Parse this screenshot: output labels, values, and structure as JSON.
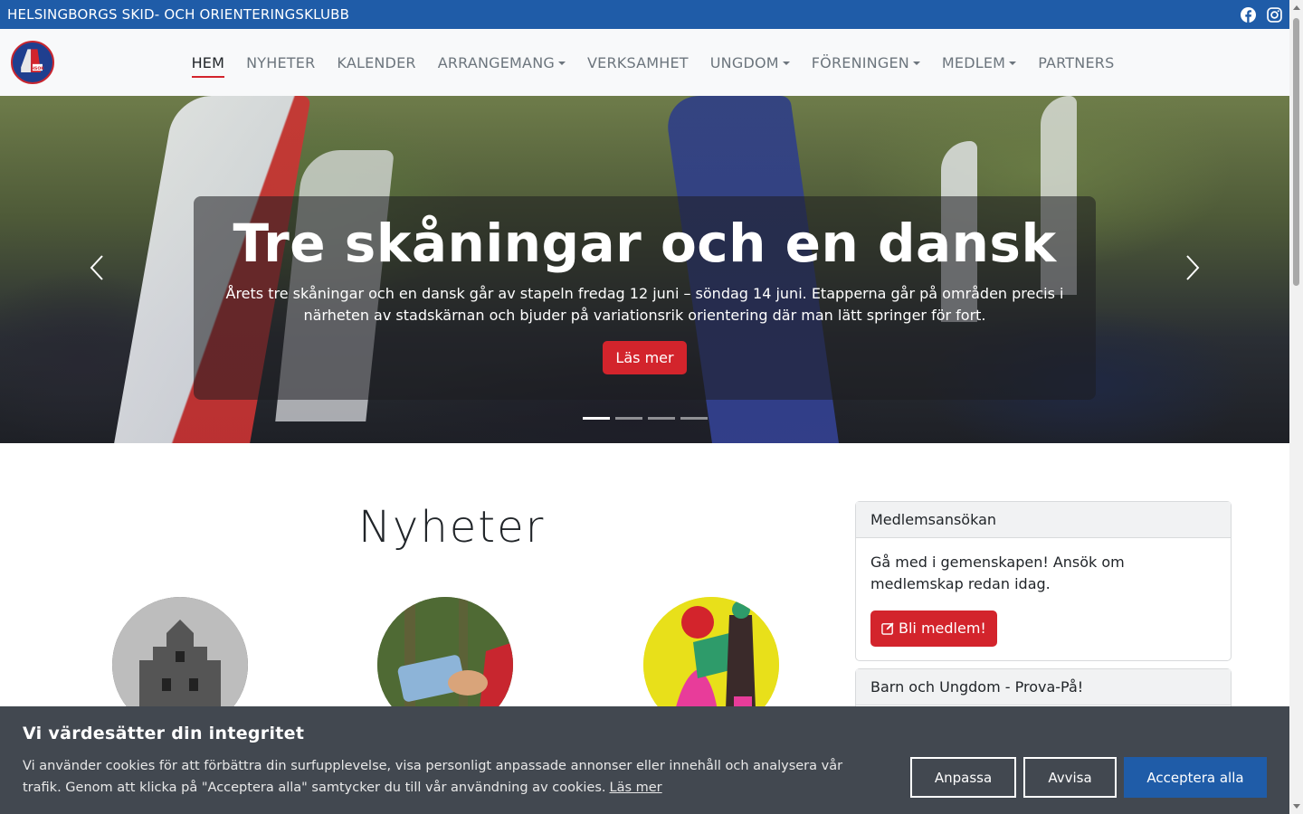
{
  "topbar": {
    "site_title": "HELSINGBORGS SKID- OCH ORIENTERINGSKLUBB",
    "icons": [
      "facebook-icon",
      "instagram-icon"
    ],
    "color": "#1f5ca8"
  },
  "nav": {
    "logo_text": "HSOK",
    "items": [
      {
        "label": "HEM",
        "active": true,
        "dropdown": false
      },
      {
        "label": "NYHETER",
        "active": false,
        "dropdown": false
      },
      {
        "label": "KALENDER",
        "active": false,
        "dropdown": false
      },
      {
        "label": "ARRANGEMANG",
        "active": false,
        "dropdown": true
      },
      {
        "label": "VERKSAMHET",
        "active": false,
        "dropdown": false
      },
      {
        "label": "UNGDOM",
        "active": false,
        "dropdown": true
      },
      {
        "label": "FÖRENINGEN",
        "active": false,
        "dropdown": true
      },
      {
        "label": "MEDLEM",
        "active": false,
        "dropdown": true
      },
      {
        "label": "PARTNERS",
        "active": false,
        "dropdown": false
      }
    ]
  },
  "hero": {
    "title": "Tre skåningar och en dansk",
    "text": "Årets tre skåningar och en dansk går av stapeln fredag 12 juni – söndag 14 juni. Etapperna går på områden precis i närheten av stadskärnan och bjuder på variationsrik orientering där man lätt springer för fort.",
    "button": "Läs mer",
    "slide_count": 4,
    "active_slide": 1
  },
  "news": {
    "heading": "Nyheter"
  },
  "sidebar": {
    "membership": {
      "header": "Medlemsansökan",
      "body": "Gå med i gemenskapen! Ansök om medlemskap redan idag.",
      "button": "Bli medlem!"
    },
    "youth": {
      "header": "Barn och Ungdom - Prova-På!"
    }
  },
  "cookie": {
    "title": "Vi värdesätter din integritet",
    "text": "Vi använder cookies för att förbättra din surfupplevelse, visa personligt anpassade annonser eller innehåll och analysera vår trafik. Genom att klicka på \"Acceptera alla\" samtycker du till vår användning av cookies.",
    "read_more": "Läs mer",
    "customize": "Anpassa",
    "reject": "Avvisa",
    "accept": "Acceptera alla"
  },
  "colors": {
    "brand_blue": "#1f5ca8",
    "brand_red": "#d3242c"
  }
}
